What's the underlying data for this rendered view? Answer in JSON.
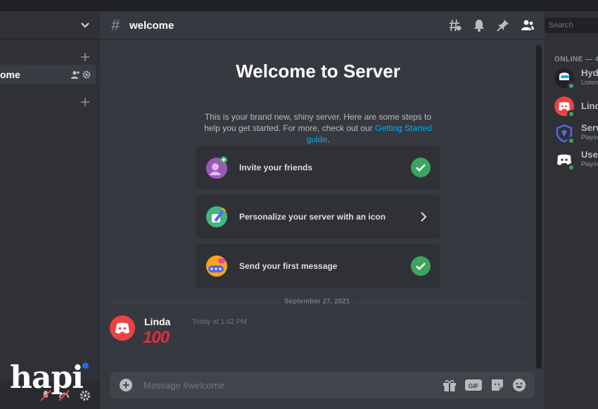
{
  "sidebar": {
    "channel_name": "ome"
  },
  "chat": {
    "channel_title": "welcome",
    "hash_symbol": "#"
  },
  "search": {
    "placeholder": "Search"
  },
  "welcome": {
    "title": "Welcome to Server",
    "desc_text": "This is your brand new, shiny server. Here are some steps to help you get started. For more, check out our ",
    "desc_link": "Getting Started guide",
    "desc_end": ".",
    "steps": [
      {
        "label": "Invite your friends",
        "state": "done"
      },
      {
        "label": "Personalize your server with an icon",
        "state": "arrow"
      },
      {
        "label": "Send your first message",
        "state": "done"
      }
    ]
  },
  "divider_date": "September 27, 2021",
  "message": {
    "author": "Linda",
    "time": "Today at 1:42 PM",
    "content": "100"
  },
  "composer": {
    "placeholder": "Message #welcome"
  },
  "members": {
    "heading": "ONLINE — 4",
    "list": [
      {
        "name": "Hyd",
        "status": "Listen"
      },
      {
        "name": "Lind",
        "status": ""
      },
      {
        "name": "Serv",
        "status": "Playin"
      },
      {
        "name": "Use",
        "status": "Playin"
      }
    ]
  },
  "watermark": "hapi",
  "colors": {
    "accent_link": "#00aff4",
    "online_green": "#3ba55d",
    "discord_red": "#ed4245",
    "blurple": "#5865f2"
  }
}
